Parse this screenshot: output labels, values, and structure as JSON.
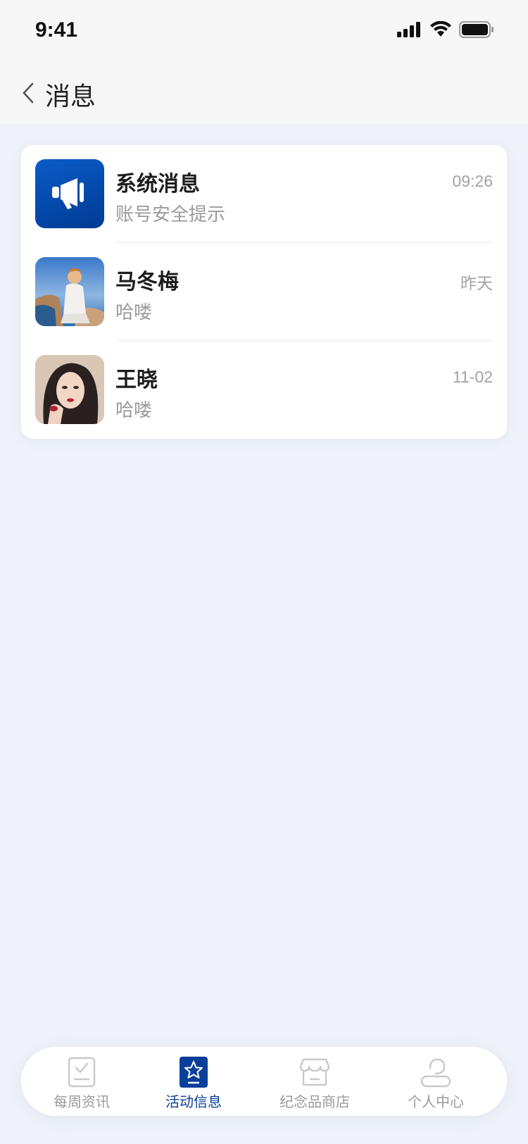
{
  "status_bar": {
    "time": "9:41"
  },
  "nav": {
    "title": "消息"
  },
  "messages": [
    {
      "name": "系统消息",
      "preview": "账号安全提示",
      "time": "09:26",
      "avatar": "megaphone-icon"
    },
    {
      "name": "马冬梅",
      "preview": "哈喽",
      "time": "昨天",
      "avatar": "photo"
    },
    {
      "name": "王晓",
      "preview": "哈喽",
      "time": "11-02",
      "avatar": "photo"
    }
  ],
  "tabbar": {
    "items": [
      {
        "label": "每周资讯",
        "icon": "checklist-icon",
        "active": false
      },
      {
        "label": "活动信息",
        "icon": "star-icon",
        "active": true
      },
      {
        "label": "纪念品商店",
        "icon": "store-icon",
        "active": false
      },
      {
        "label": "个人中心",
        "icon": "person-icon",
        "active": false
      }
    ]
  },
  "colors": {
    "accent": "#0a3f99",
    "background": "#eff3f9"
  }
}
